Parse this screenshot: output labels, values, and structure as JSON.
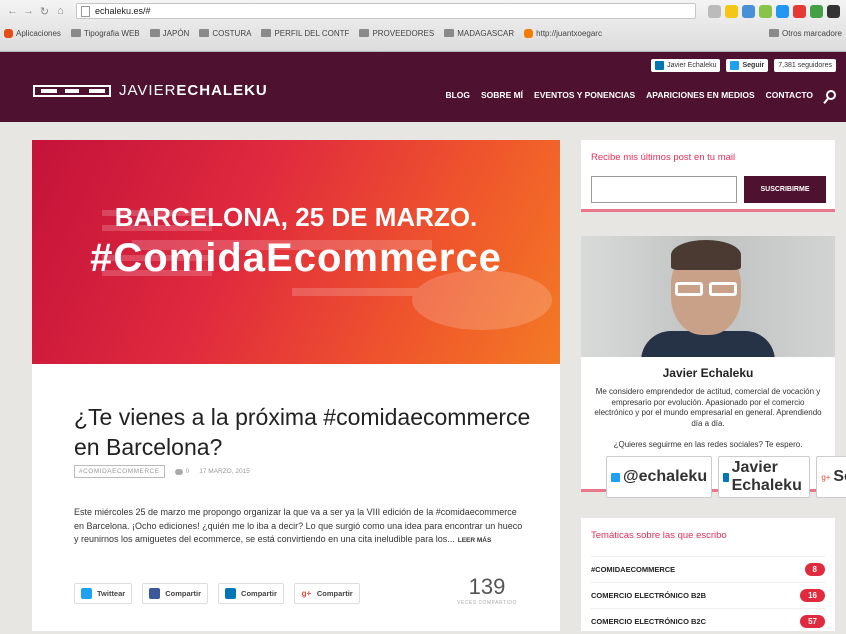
{
  "browser": {
    "url": "echaleku.es/#",
    "bookmarks": [
      "Aplicaciones",
      "Tipografia WEB",
      "JAPÓN",
      "COSTURA",
      "PERFIL DEL CONTF",
      "PROVEEDORES",
      "MADAGASCAR",
      "http://juantxoegarc",
      "Otros marcadore"
    ]
  },
  "header": {
    "brand_light": "JAVIER",
    "brand_bold": "ECHALEKU",
    "linkedin": "Javier Echaleku",
    "twitter_follow": "Seguir",
    "twitter_count": "7,381 seguidores",
    "menu": [
      "BLOG",
      "SOBRE MÍ",
      "EVENTOS Y PONENCIAS",
      "APARICIONES EN MEDIOS",
      "CONTACTO"
    ]
  },
  "hero": {
    "line1": "BARCELONA, 25 DE MARZO.",
    "line2": "#ComidaEcommerce"
  },
  "post": {
    "title": "¿Te vienes a la próxima #comidaecommerce en Barcelona?",
    "tag": "#COMIDAECOMMERCE",
    "comments": "0",
    "date": "17 MARZO, 2015",
    "excerpt": "Este miércoles 25 de marzo me propongo organizar la que va a ser ya la VIII edición de la #comidaecommerce en Barcelona. ¡Ocho ediciones! ¿quién me lo iba a decir? Lo que surgió como una idea para encontrar un hueco y reunirnos los amiguetes del ecommerce, se está convirtiendo en una cita ineludible para los...",
    "read_more": "LEER MÁS",
    "share": [
      "Twittear",
      "Compartir",
      "Compartir",
      "Compartir"
    ],
    "share_count": "139",
    "share_label": "VECES COMPARTIDO"
  },
  "subscribe": {
    "heading": "Recibe mis últimos post en tu mail",
    "button": "SUSCRIBIRME"
  },
  "bio": {
    "name": "Javier Echaleku",
    "text": "Me considero emprendedor de actitud, comercial de vocación y empresario por evolución. Apasionado por el comercio electrónico y por el mundo empresarial en general. Aprendiendo día a día.",
    "question": "¿Quieres seguirme en las redes sociales? Te espero.",
    "twitter": "@echaleku",
    "linkedin": "Javier Echaleku",
    "gplus": "Seguir"
  },
  "topics": {
    "heading": "Temáticas sobre las que escribo",
    "items": [
      {
        "label": "#COMIDAECOMMERCE",
        "count": "8"
      },
      {
        "label": "COMERCIO ELECTRÓNICO B2B",
        "count": "16"
      },
      {
        "label": "COMERCIO ELECTRÓNICO B2C",
        "count": "57"
      }
    ]
  },
  "colors": {
    "brand": "#4e1230",
    "accent": "#e02a3e"
  }
}
